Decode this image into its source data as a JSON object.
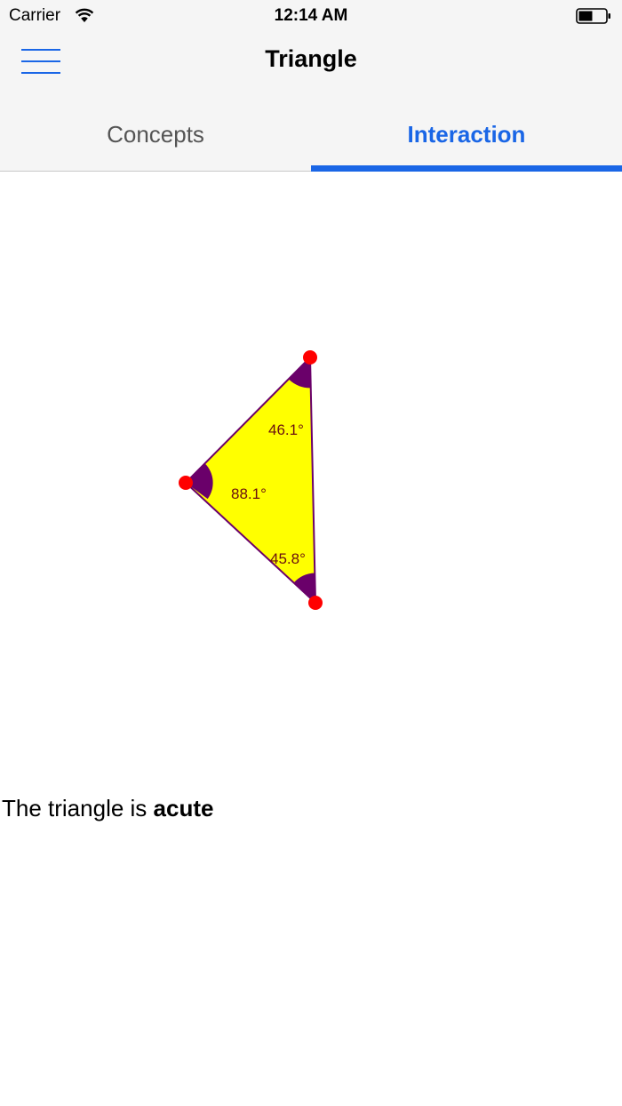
{
  "status_bar": {
    "carrier": "Carrier",
    "time": "12:14 AM",
    "icons": [
      "wifi-icon",
      "battery-icon"
    ]
  },
  "nav": {
    "title": "Triangle",
    "menu_icon": "hamburger-menu-icon"
  },
  "tabs": [
    {
      "label": "Concepts",
      "selected": false
    },
    {
      "label": "Interaction",
      "selected": true
    }
  ],
  "triangle": {
    "angles": {
      "top": "46.1°",
      "left": "88.1°",
      "bottom": "45.8°"
    }
  },
  "result": {
    "prefix": "The triangle is ",
    "classification": "acute"
  },
  "colors": {
    "accent": "#1a66e6",
    "triangle_fill": "#ffff00",
    "triangle_stroke": "#6a006a",
    "angle_arc": "#6a006a",
    "handle": "#ff0000",
    "angle_text": "#6a1010"
  }
}
